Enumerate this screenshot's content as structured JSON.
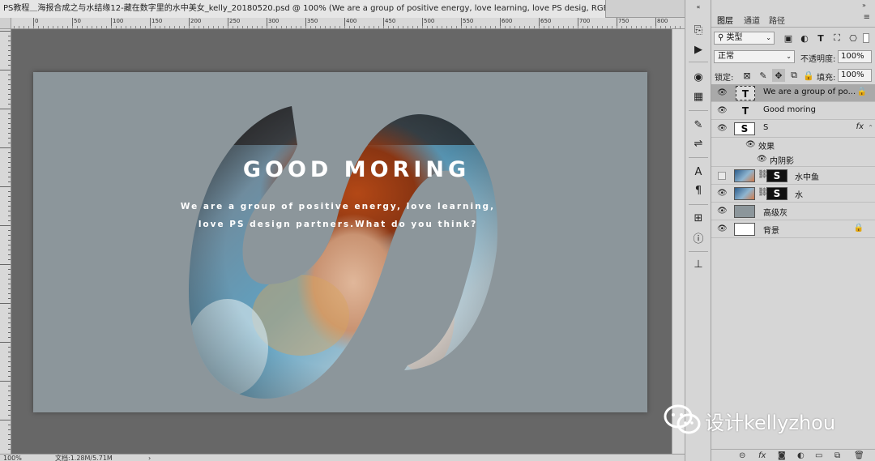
{
  "document": {
    "tab_title": "PS教程＿海报合成之与水结缘12-藏在数字里的水中美女_kelly_20180520.psd @ 100% (We are a group of positive energy, love learning,  love PS desig, RGB/8#) *",
    "close": "×"
  },
  "ruler": {
    "labels": [
      "0",
      "50",
      "100",
      "150",
      "200",
      "250",
      "300",
      "350",
      "400",
      "450",
      "500",
      "550",
      "600",
      "650",
      "700",
      "750",
      "800"
    ]
  },
  "poster": {
    "title": "GOOD MORING",
    "subtitle_line1": "We are a group of positive energy, love learning,",
    "subtitle_line2": "love PS design partners.What do you think?",
    "background_color": "#8c969b"
  },
  "status": {
    "zoom": "100%",
    "doc_size": "文档:1.28M/5.71M",
    "arrow": "›"
  },
  "panel": {
    "tabs": [
      "图层",
      "通道",
      "路径"
    ],
    "filter_kind": "类型",
    "blend_mode": "正常",
    "opacity_label": "不透明度:",
    "opacity_value": "100%",
    "lock_label": "锁定:",
    "fill_label": "填充:",
    "fill_value": "100%"
  },
  "layers": [
    {
      "name": "We are a group of po...",
      "kind": "text",
      "visible": true,
      "selected": true,
      "locked": true
    },
    {
      "name": "Good moring",
      "kind": "text",
      "visible": true
    },
    {
      "name": "S",
      "kind": "smart",
      "visible": true,
      "fx": "fx"
    },
    {
      "name": "效果",
      "kind": "effects-group",
      "visible": true
    },
    {
      "name": "内阴影",
      "kind": "effect",
      "visible": true
    },
    {
      "name": "水中鱼",
      "kind": "masked",
      "visible": false
    },
    {
      "name": "水",
      "kind": "masked",
      "visible": true
    },
    {
      "name": "高级灰",
      "kind": "fill",
      "visible": true
    },
    {
      "name": "背景",
      "kind": "background",
      "visible": true,
      "locked": true
    }
  ],
  "watermark": {
    "text": "设计kellyzhou"
  },
  "colors": {
    "selected_layer": "#a9a9a9",
    "panel_bg": "#d6d6d6",
    "workspace": "#676767"
  }
}
